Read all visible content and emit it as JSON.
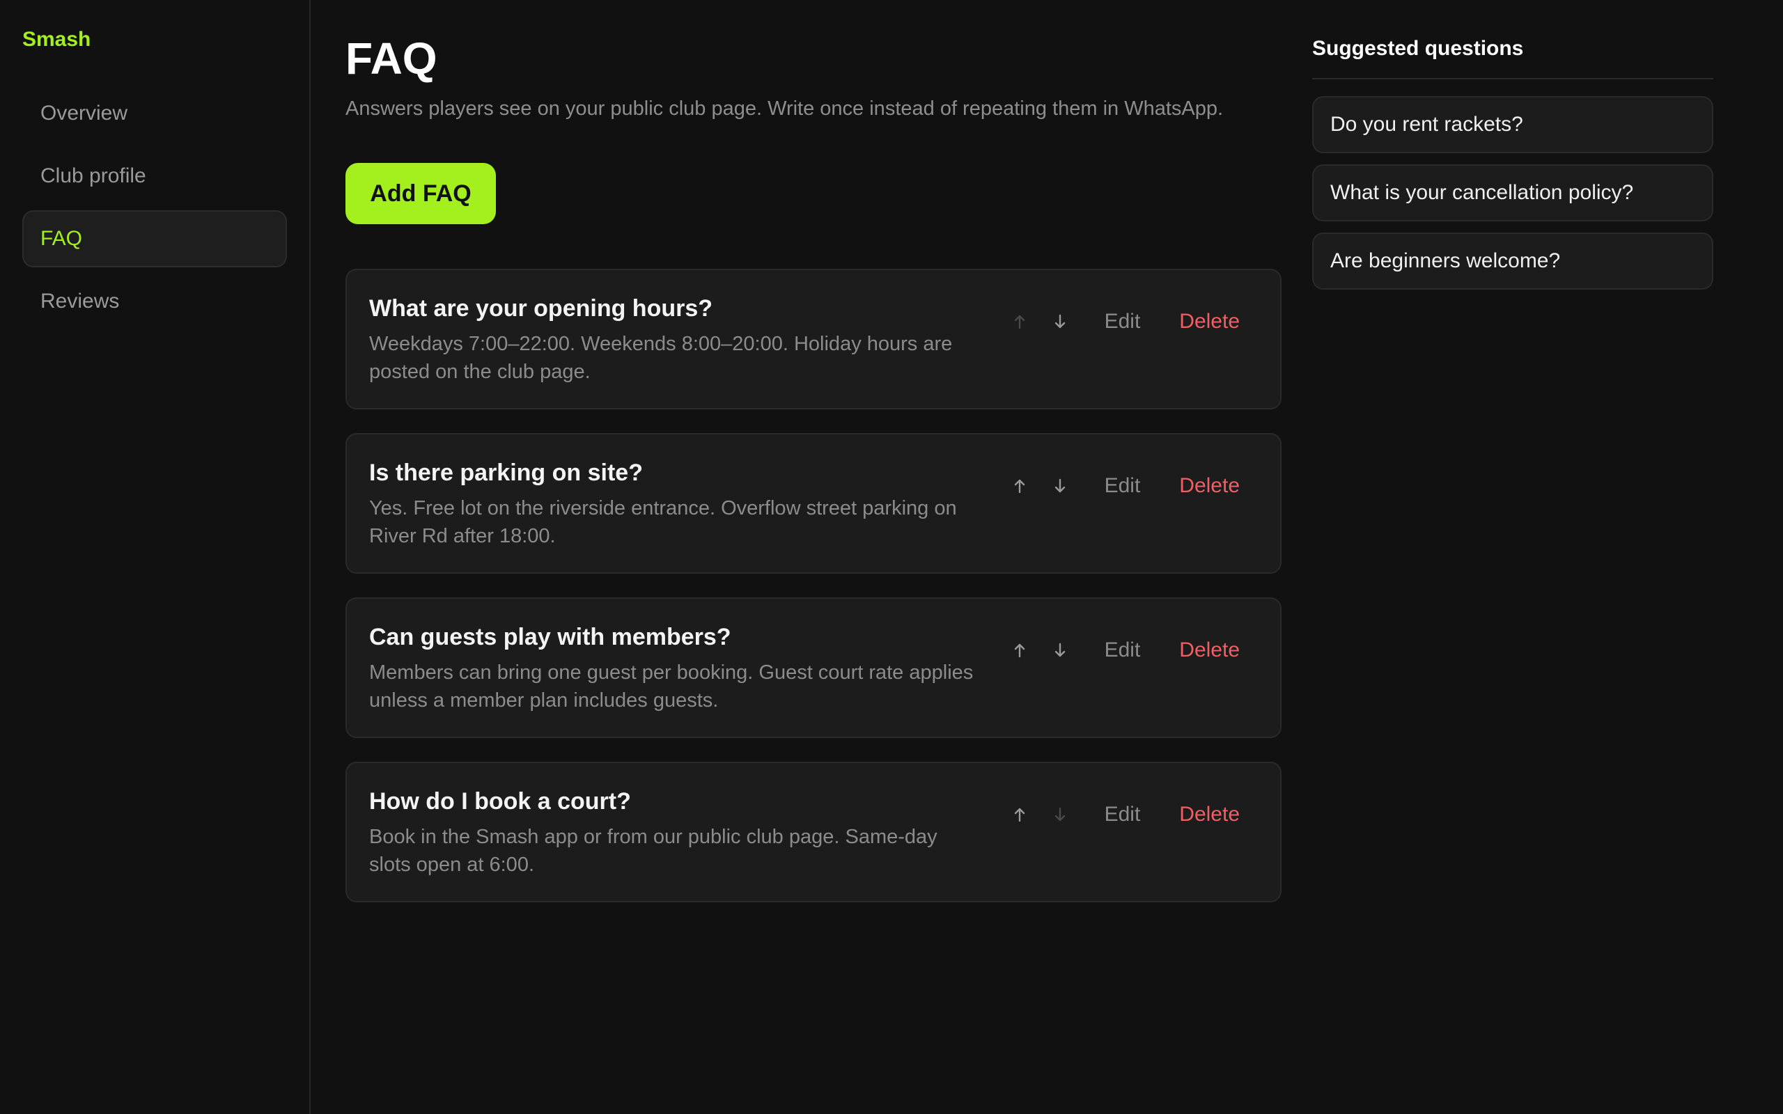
{
  "brand": "Smash",
  "sidebar": {
    "items": [
      {
        "label": "Overview",
        "active": false
      },
      {
        "label": "Club profile",
        "active": false
      },
      {
        "label": "FAQ",
        "active": true
      },
      {
        "label": "Reviews",
        "active": false
      }
    ]
  },
  "main": {
    "title": "FAQ",
    "subtitle": "Answers players see on your public club page. Write once instead of repeating them in WhatsApp.",
    "add_button": "Add FAQ",
    "faqs": [
      {
        "question": "What are your opening hours?",
        "answer": "Weekdays 7:00–22:00. Weekends 8:00–20:00. Holiday hours are posted on the club page.",
        "edit": "Edit",
        "delete": "Delete",
        "move_up_enabled": false,
        "move_down_enabled": true
      },
      {
        "question": "Is there parking on site?",
        "answer": "Yes. Free lot on the riverside entrance. Overflow street parking on River Rd after 18:00.",
        "edit": "Edit",
        "delete": "Delete",
        "move_up_enabled": true,
        "move_down_enabled": true
      },
      {
        "question": "Can guests play with members?",
        "answer": "Members can bring one guest per booking. Guest court rate applies unless a member plan includes guests.",
        "edit": "Edit",
        "delete": "Delete",
        "move_up_enabled": true,
        "move_down_enabled": true
      },
      {
        "question": "How do I book a court?",
        "answer": "Book in the Smash app or from our public club page. Same-day slots open at 6:00.",
        "edit": "Edit",
        "delete": "Delete",
        "move_up_enabled": true,
        "move_down_enabled": false
      }
    ]
  },
  "suggested": {
    "title": "Suggested questions",
    "items": [
      "Do you rent rackets?",
      "What is your cancellation policy?",
      "Are beginners welcome?"
    ]
  },
  "icons": {
    "move_up": "arrow-up-icon",
    "move_down": "arrow-down-icon"
  },
  "colors": {
    "accent": "#a3f01e",
    "danger": "#ef5f63",
    "background": "#111111",
    "card": "#1c1c1c"
  }
}
